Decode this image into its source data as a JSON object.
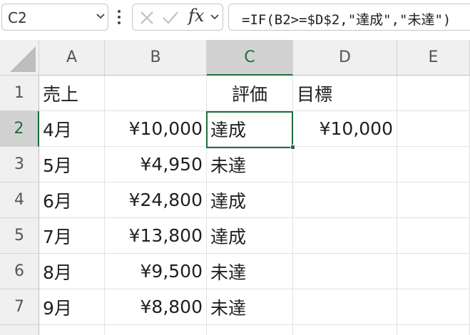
{
  "name_box": {
    "value": "C2"
  },
  "formula_bar": {
    "formula": "=IF(B2>=$D$2,\"達成\",\"未達\")"
  },
  "columns": [
    "A",
    "B",
    "C",
    "D",
    "E"
  ],
  "rows": [
    "1",
    "2",
    "3",
    "4",
    "5",
    "6",
    "7"
  ],
  "cells": {
    "A1": "売上",
    "C1": "評価",
    "D1": "目標",
    "A2": "4月",
    "B2": "¥10,000",
    "C2": "達成",
    "D2": "¥10,000",
    "A3": "5月",
    "B3": "¥4,950",
    "C3": "未達",
    "A4": "6月",
    "B4": "¥24,800",
    "C4": "達成",
    "A5": "7月",
    "B5": "¥13,800",
    "C5": "達成",
    "A6": "8月",
    "B6": "¥9,500",
    "C6": "未達",
    "A7": "9月",
    "B7": "¥8,800",
    "C7": "未達"
  },
  "selected_cell": "C2",
  "colors": {
    "accent": "#1e6d3b",
    "header_bg": "#f0f0f0",
    "header_active_bg": "#d2d2d2",
    "gridline": "#e1e1e1"
  }
}
